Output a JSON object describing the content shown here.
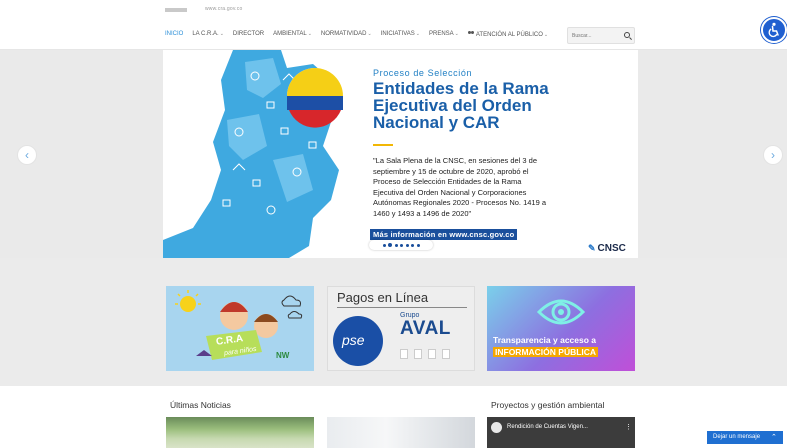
{
  "topbar": {
    "text": "www.cra.gov.co"
  },
  "nav": {
    "items": [
      {
        "label": "INICIO",
        "caret": false,
        "active": true
      },
      {
        "label": "LA C.R.A.",
        "caret": true
      },
      {
        "label": "DIRECTOR",
        "caret": false
      },
      {
        "label": "AMBIENTAL",
        "caret": true
      },
      {
        "label": "NORMATIVIDAD",
        "caret": true
      },
      {
        "label": "INICIATIVAS",
        "caret": true
      },
      {
        "label": "PRENSA",
        "caret": true
      },
      {
        "label": "ATENCIÓN AL PÚBLICO",
        "caret": true,
        "icon": "people-icon"
      }
    ],
    "search_placeholder": "Buscar..."
  },
  "hero": {
    "kicker": "Proceso de Selección",
    "title_lines": [
      "Entidades de la Rama",
      "Ejecutiva del Orden",
      "Nacional y CAR"
    ],
    "quote": "\"La Sala Plena de la CNSC, en sesiones del 3 de septiembre y 15 de octubre de 2020, aprobó el Proceso de Selección  Entidades de la Rama Ejecutiva del Orden Nacional y Corporaciones Autónomas Regionales 2020 - Procesos No. 1419 a 1460 y 1493 a 1496 de 2020\"",
    "link": "Más información en www.cnsc.gov.co",
    "brand": "CNSC",
    "slide_count": 7,
    "active_slide": 1
  },
  "cards": {
    "cra_kids": {
      "label": "C.R.A",
      "sub": "para niños"
    },
    "pagos": {
      "title": "Pagos en Línea",
      "pse": "pse",
      "grupo": "Grupo",
      "aval": "AVAL"
    },
    "transparencia": {
      "line1": "Transparencia y acceso a",
      "line2": "INFORMACIÓN PÚBLICA"
    }
  },
  "sections": {
    "news_heading": "Últimas Noticias",
    "projects_heading": "Proyectos y gestión ambiental",
    "video_title": "Rendición de Cuentas Vigen..."
  },
  "chat": {
    "label": "Dejar un mensaje"
  },
  "colors": {
    "primary_blue": "#1a5fa8",
    "nav_active": "#2a8fd8",
    "chat_blue": "#1f6fd1",
    "accent_yellow": "#f2b705"
  }
}
